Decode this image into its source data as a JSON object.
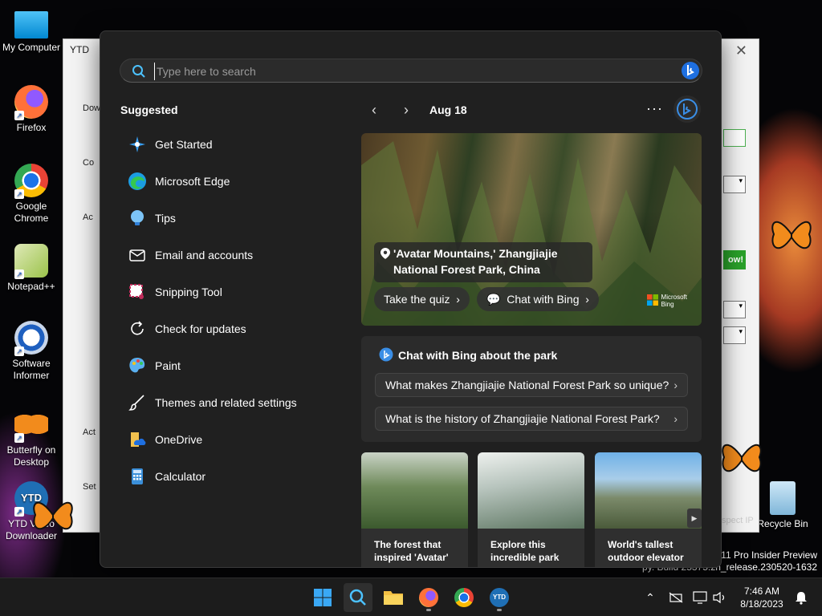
{
  "desktop": {
    "icons": [
      {
        "label": "My Computer"
      },
      {
        "label": "Firefox"
      },
      {
        "label": "Google Chrome"
      },
      {
        "label": "Notepad++"
      },
      {
        "label": "Software Informer"
      },
      {
        "label": "Butterfly on Desktop"
      },
      {
        "label": "YTD Video Downloader"
      },
      {
        "label": "Recycle Bin"
      }
    ],
    "win_info_line1": "s 11 Pro Insider Preview",
    "win_info_line2": "py. Build 25375.zn_release.230520-1632"
  },
  "bg_window": {
    "title": "YTD",
    "side_labels": [
      "Dow",
      "Co",
      "Ac",
      "Act",
      "Set"
    ],
    "green_btn": "ow!",
    "inspect_label": "spect IP"
  },
  "search": {
    "placeholder": "Type here to search",
    "suggested_title": "Suggested",
    "apps": [
      {
        "label": "Get Started",
        "icon": "get-started-icon"
      },
      {
        "label": "Microsoft Edge",
        "icon": "edge-icon"
      },
      {
        "label": "Tips",
        "icon": "tips-icon"
      },
      {
        "label": "Email and accounts",
        "icon": "mail-icon"
      },
      {
        "label": "Snipping Tool",
        "icon": "snipping-tool-icon"
      },
      {
        "label": "Check for updates",
        "icon": "update-icon"
      },
      {
        "label": "Paint",
        "icon": "paint-icon"
      },
      {
        "label": "Themes and related settings",
        "icon": "brush-icon"
      },
      {
        "label": "OneDrive",
        "icon": "onedrive-icon"
      },
      {
        "label": "Calculator",
        "icon": "calculator-icon"
      }
    ],
    "highlights": {
      "date": "Aug 18",
      "hero_caption_line1": "'Avatar Mountains,' Zhangjiajie",
      "hero_caption_line2": "National Forest Park, China",
      "quiz_label": "Take the quiz",
      "chat_label": "Chat with Bing",
      "logo_line1": "Microsoft",
      "logo_line2": "Bing",
      "chat_card_title": "Chat with Bing about the park",
      "questions": [
        "What makes Zhangjiajie National Forest Park so unique?",
        "What is the history of Zhangjiajie National Forest Park?"
      ],
      "thumbnails": [
        {
          "line1": "The forest that",
          "line2": "inspired 'Avatar'"
        },
        {
          "line1": "Explore this",
          "line2": "incredible park"
        },
        {
          "line1": "World's tallest",
          "line2": "outdoor elevator"
        }
      ]
    }
  },
  "taskbar": {
    "time": "7:46 AM",
    "date": "8/18/2023"
  },
  "colors": {
    "accent": "#4cc2ff",
    "flyout_bg": "#202020",
    "card_bg": "#2b2b2b"
  }
}
